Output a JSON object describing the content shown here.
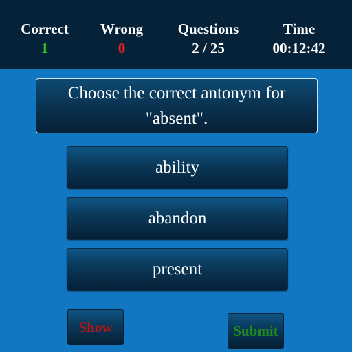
{
  "stats": {
    "correct": {
      "label": "Correct",
      "value": "1",
      "color": "#22d122"
    },
    "wrong": {
      "label": "Wrong",
      "value": "0",
      "color": "#e8251a"
    },
    "questions": {
      "label": "Questions",
      "value": "2 / 25",
      "color": "#ffffff"
    },
    "time": {
      "label": "Time",
      "value": "00:12:42",
      "color": "#ffffff"
    }
  },
  "question": {
    "text": "Choose the correct antonym for \"absent\"."
  },
  "options": [
    {
      "label": "ability"
    },
    {
      "label": "abandon"
    },
    {
      "label": "present"
    }
  ],
  "buttons": {
    "show": {
      "label": "Show",
      "color": "#b01818"
    },
    "submit": {
      "label": "Submit",
      "color": "#1f8a1f"
    }
  },
  "colors": {
    "background": "#1277c2",
    "header": "#062238"
  }
}
